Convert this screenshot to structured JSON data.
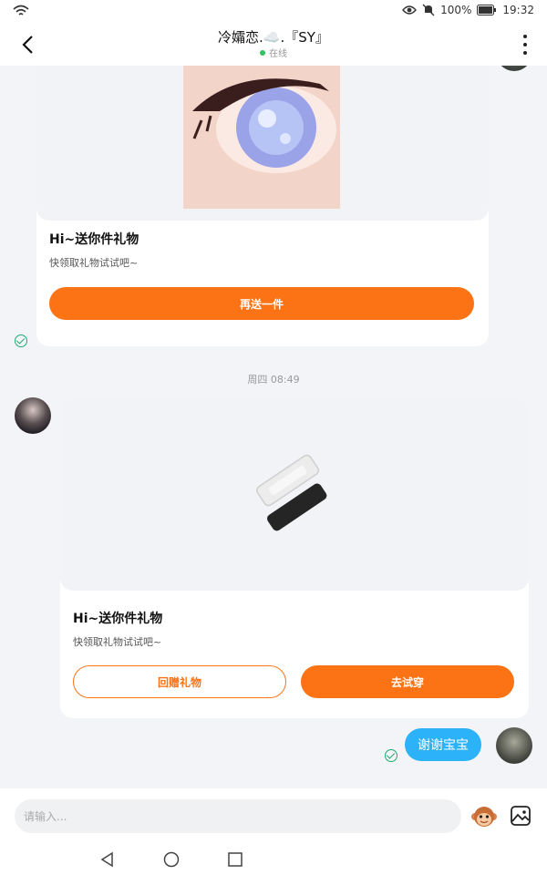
{
  "status_bar": {
    "battery": "100%",
    "time": "19:32"
  },
  "header": {
    "title": "冷孀恋.☁️.『SY』",
    "status": "在线"
  },
  "messages": {
    "card1": {
      "title": "Hi~送你件礼物",
      "subtitle": "快领取礼物试试吧~",
      "button": "再送一件"
    },
    "timestamp": "周四 08:49",
    "card2": {
      "title": "Hi~送你件礼物",
      "subtitle": "快领取礼物试试吧~",
      "button_left": "回赠礼物",
      "button_right": "去试穿"
    },
    "reply": "谢谢宝宝"
  },
  "input": {
    "placeholder": "请输入..."
  },
  "colors": {
    "accent": "#fb7315",
    "bubble": "#2bb2f8",
    "check": "#22a872",
    "online": "#32c35e"
  }
}
